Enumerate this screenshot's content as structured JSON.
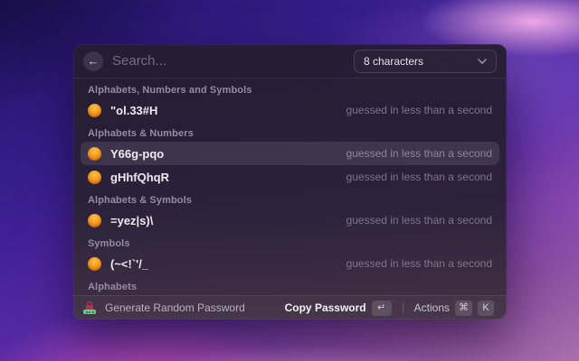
{
  "window": {
    "search": {
      "placeholder": "Search..."
    },
    "length_dropdown": {
      "value": "8 characters"
    },
    "sections": [
      {
        "title": "Alphabets, Numbers and Symbols",
        "rows": [
          {
            "password": "\"ol.33#H",
            "strength": "guessed in less than a second",
            "selected": false
          }
        ]
      },
      {
        "title": "Alphabets & Numbers",
        "rows": [
          {
            "password": "Y66g-pqo",
            "strength": "guessed in less than a second",
            "selected": true
          },
          {
            "password": "gHhfQhqR",
            "strength": "guessed in less than a second",
            "selected": false
          }
        ]
      },
      {
        "title": "Alphabets & Symbols",
        "rows": [
          {
            "password": "=yez|s)\\",
            "strength": "guessed in less than a second",
            "selected": false
          }
        ]
      },
      {
        "title": "Symbols",
        "rows": [
          {
            "password": "(~<!`'/_",
            "strength": "guessed in less than a second",
            "selected": false
          }
        ]
      },
      {
        "title": "Alphabets",
        "rows": []
      }
    ],
    "footer": {
      "command_label": "Generate Random Password",
      "primary_action": "Copy Password",
      "primary_key": "↵",
      "secondary_action": "Actions",
      "secondary_key_1": "⌘",
      "secondary_key_2": "K"
    },
    "colors": {
      "accent_orange": "#f79d1e",
      "selected_row": "rgba(255,255,255,0.10)",
      "panel_bg": "#2a2036",
      "strength_text": "#7e7689"
    }
  }
}
